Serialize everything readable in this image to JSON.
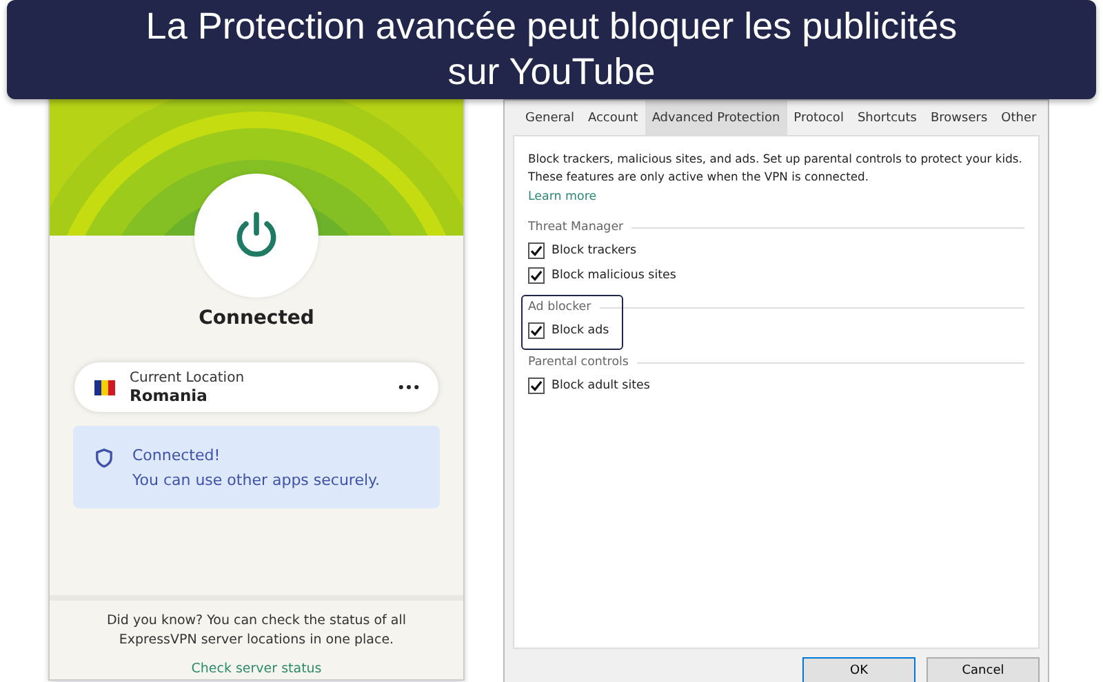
{
  "banner": {
    "title": "La Protection avancée peut bloquer les publicités sur YouTube"
  },
  "vpn_app": {
    "status": "Connected",
    "location": {
      "label": "Current Location",
      "country": "Romania"
    },
    "notice": {
      "title": "Connected!",
      "text": "You can use other apps securely."
    },
    "tip": {
      "text": "Did you know? You can check the status of all ExpressVPN server locations in one place.",
      "link": "Check server status"
    }
  },
  "settings": {
    "tabs": [
      {
        "label": "General",
        "selected": false
      },
      {
        "label": "Account",
        "selected": false
      },
      {
        "label": "Advanced Protection",
        "selected": true
      },
      {
        "label": "Protocol",
        "selected": false
      },
      {
        "label": "Shortcuts",
        "selected": false
      },
      {
        "label": "Browsers",
        "selected": false
      },
      {
        "label": "Other",
        "selected": false
      }
    ],
    "description": "Block trackers, malicious sites, and ads. Set up parental controls to protect your kids. These features are only active when the VPN is connected.",
    "learn_more": "Learn more",
    "groups": [
      {
        "title": "Threat Manager",
        "highlighted": false,
        "options": [
          {
            "label": "Block trackers",
            "checked": true
          },
          {
            "label": "Block malicious sites",
            "checked": true
          }
        ]
      },
      {
        "title": "Ad blocker",
        "highlighted": true,
        "options": [
          {
            "label": "Block ads",
            "checked": true
          }
        ]
      },
      {
        "title": "Parental controls",
        "highlighted": false,
        "options": [
          {
            "label": "Block adult sites",
            "checked": true
          }
        ]
      }
    ],
    "buttons": [
      "OK",
      "Cancel"
    ]
  }
}
